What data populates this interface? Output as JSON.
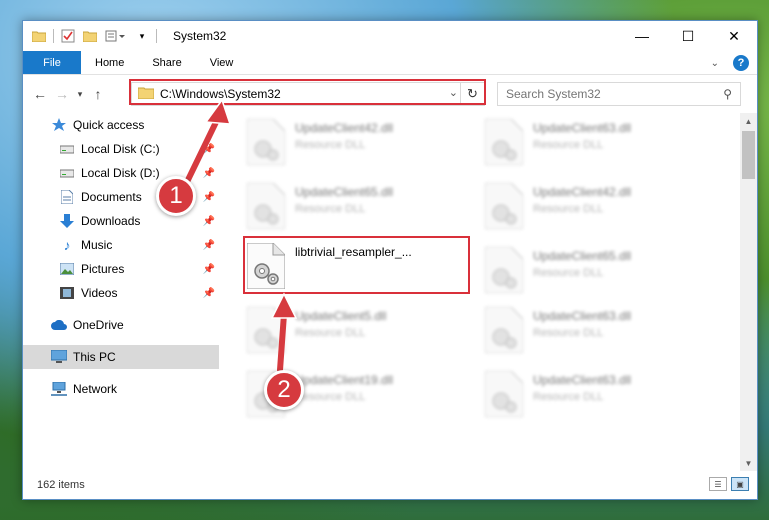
{
  "window": {
    "title": "System32",
    "controls": {
      "minimize": "—",
      "maximize": "☐",
      "close": "✕"
    }
  },
  "ribbon": {
    "tabs": [
      {
        "label": "File"
      },
      {
        "label": "Home"
      },
      {
        "label": "Share"
      },
      {
        "label": "View"
      }
    ]
  },
  "address": {
    "path": "C:\\Windows\\System32",
    "search_placeholder": "Search System32"
  },
  "sidebar": {
    "items": [
      {
        "label": "Quick access",
        "icon": "star-icon",
        "pinned": false
      },
      {
        "label": "Local Disk (C:)",
        "icon": "drive-icon",
        "pinned": true
      },
      {
        "label": "Local Disk (D:)",
        "icon": "drive-icon",
        "pinned": true
      },
      {
        "label": "Documents",
        "icon": "documents-icon",
        "pinned": true
      },
      {
        "label": "Downloads",
        "icon": "download-icon",
        "pinned": true
      },
      {
        "label": "Music",
        "icon": "music-icon",
        "pinned": true
      },
      {
        "label": "Pictures",
        "icon": "pictures-icon",
        "pinned": true
      },
      {
        "label": "Videos",
        "icon": "videos-icon",
        "pinned": true
      },
      {
        "label": "OneDrive",
        "icon": "cloud-icon",
        "pinned": false
      },
      {
        "label": "This PC",
        "icon": "computer-icon",
        "pinned": false,
        "selected": true
      },
      {
        "label": "Network",
        "icon": "network-icon",
        "pinned": false
      }
    ]
  },
  "files": [
    {
      "name": "UpdateClient42.dll",
      "type": "Resource DLL",
      "blurred": true
    },
    {
      "name": "UpdateClient63.dll",
      "type": "Resource DLL",
      "blurred": true
    },
    {
      "name": "UpdateClient65.dll",
      "type": "Resource DLL",
      "blurred": true
    },
    {
      "name": "UpdateClient42.dll",
      "type": "Resource DLL",
      "blurred": true
    },
    {
      "name": "libtrivial_resampler_...",
      "type": "",
      "blurred": false
    },
    {
      "name": "UpdateClient65.dll",
      "type": "Resource DLL",
      "blurred": true
    },
    {
      "name": "UpdateClient5.dll",
      "type": "Resource DLL",
      "blurred": true
    },
    {
      "name": "UpdateClient63.dll",
      "type": "Resource DLL",
      "blurred": true
    },
    {
      "name": "UpdateClient19.dll",
      "type": "Resource DLL",
      "blurred": true
    },
    {
      "name": "UpdateClient63.dll",
      "type": "Resource DLL",
      "blurred": true
    }
  ],
  "status": {
    "item_count": "162 items"
  },
  "annotations": {
    "badge1": "1",
    "badge2": "2",
    "color": "#d63a3f"
  }
}
